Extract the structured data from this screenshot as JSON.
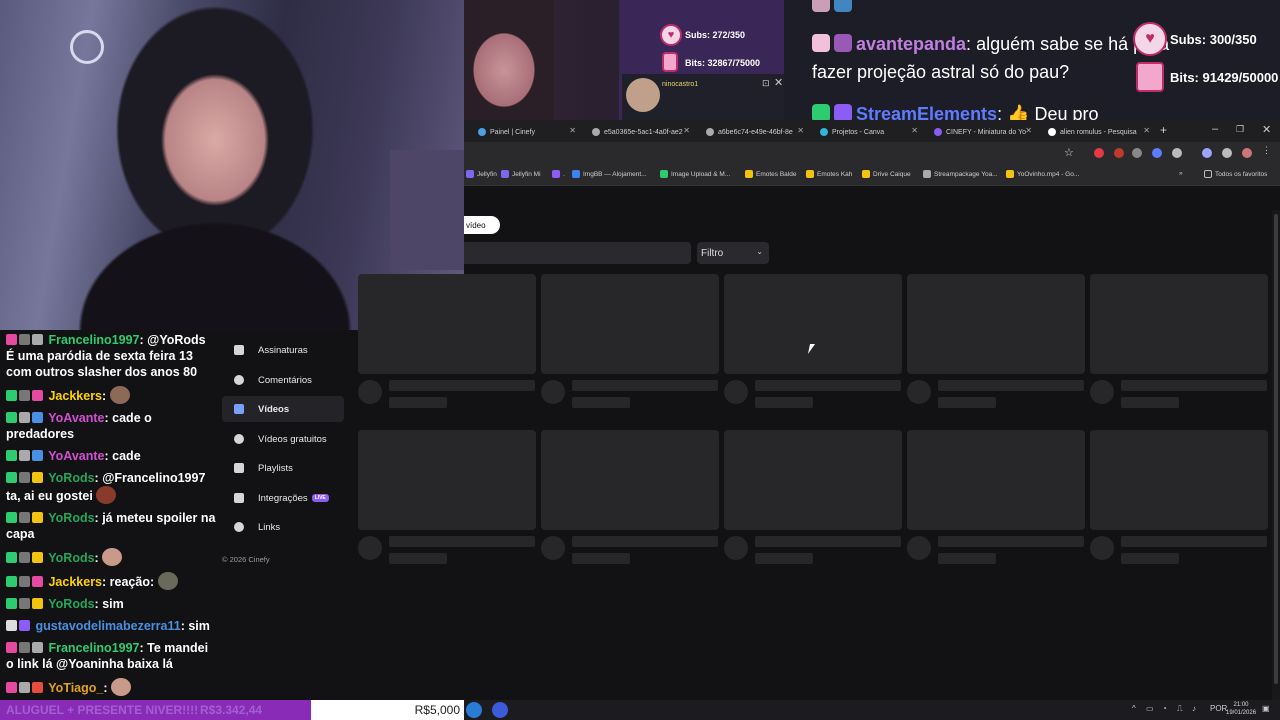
{
  "overlay": {
    "subs_small": "Subs: 272/350",
    "bits_small": "Bits: 32867/75000",
    "subs_large": "Subs: 300/350",
    "bits_large": "Bits: 91429/50000",
    "notif_name": "ninocastro1"
  },
  "top_chat": {
    "line1_rest": "alguém sabe se há para",
    "line1_user": "avantepanda",
    "line2": "fazer projeção astral só do pau?",
    "line3_user": "StreamElements",
    "line3_text": "Deu pro"
  },
  "browser": {
    "tabs": [
      {
        "label": "Painel | Cinefy"
      },
      {
        "label": "e5a0365e-5ac1-4a0f-ae2"
      },
      {
        "label": "a6be6c74-e49e-46bf-8e"
      },
      {
        "label": "Projetos - Canva"
      },
      {
        "label": "CINEFY - Miniatura do Yo"
      },
      {
        "label": "alien romulus - Pesquisa"
      }
    ],
    "new_tab": "+",
    "bookmarks": [
      "Jellyfin",
      "Jellyfin Mi",
      ".",
      "ImgBB — Alojament...",
      "Image Upload & M...",
      "Emotes Balde",
      "Emotes Kah",
      "Drive Caique",
      "Streampackage Yoa...",
      "YoOvinho.mp4 - Go..."
    ],
    "all_bookmarks": "Todos os favoritos"
  },
  "page": {
    "video_pill": "vídeo",
    "filter_label": "Filtro",
    "nav": [
      {
        "label": "Assinaturas"
      },
      {
        "label": "Comentários"
      },
      {
        "label": "Vídeos"
      },
      {
        "label": "Vídeos gratuitos"
      },
      {
        "label": "Playlists"
      },
      {
        "label": "Integrações"
      },
      {
        "label": "Links"
      }
    ],
    "live_badge": "LIVE",
    "copyright": "© 2026 Cinefy"
  },
  "chat": [
    {
      "user": "Francelino1997",
      "color": "#2ecc71",
      "text": "@YoRods É uma paródia de sexta feira 13 com outros slasher dos anos 80"
    },
    {
      "user": "Jackkers",
      "color": "#ffd400",
      "text": ""
    },
    {
      "user": "YoAvante",
      "color": "#d04fd0",
      "text": "cade o predadores"
    },
    {
      "user": "YoAvante",
      "color": "#d04fd0",
      "text": "cade"
    },
    {
      "user": "YoRods",
      "color": "#26a65b",
      "text": "@Francelino1997 ta, ai eu gostei"
    },
    {
      "user": "YoRods",
      "color": "#26a65b",
      "text": "já meteu spoiler na capa"
    },
    {
      "user": "YoRods",
      "color": "#26a65b",
      "text": ""
    },
    {
      "user": "Jackkers",
      "color": "#ffd400",
      "text": "reação:"
    },
    {
      "user": "YoRods",
      "color": "#26a65b",
      "text": "sim"
    },
    {
      "user": "gustavodelimabezerra11",
      "color": "#4a90e2",
      "text": "sim"
    },
    {
      "user": "Francelino1997",
      "color": "#2ecc71",
      "text": "Te mandei o link lá @Yoaninha baixa lá"
    },
    {
      "user": "YoTiago_",
      "color": "#e0a020",
      "text": ""
    }
  ],
  "goal": {
    "label": "ALUGUEL + PRESENTE NIVER!!!!",
    "current": "R$3.342,44",
    "target": "R$5,000",
    "progress": 0.67
  },
  "taskbar": {
    "lang": "POR",
    "time": "21:00",
    "date": "19/01/2026"
  },
  "colors": {
    "accent_purple": "#8a2bb8",
    "live_badge": "#8b5cf6",
    "skeleton": "#27272a"
  }
}
